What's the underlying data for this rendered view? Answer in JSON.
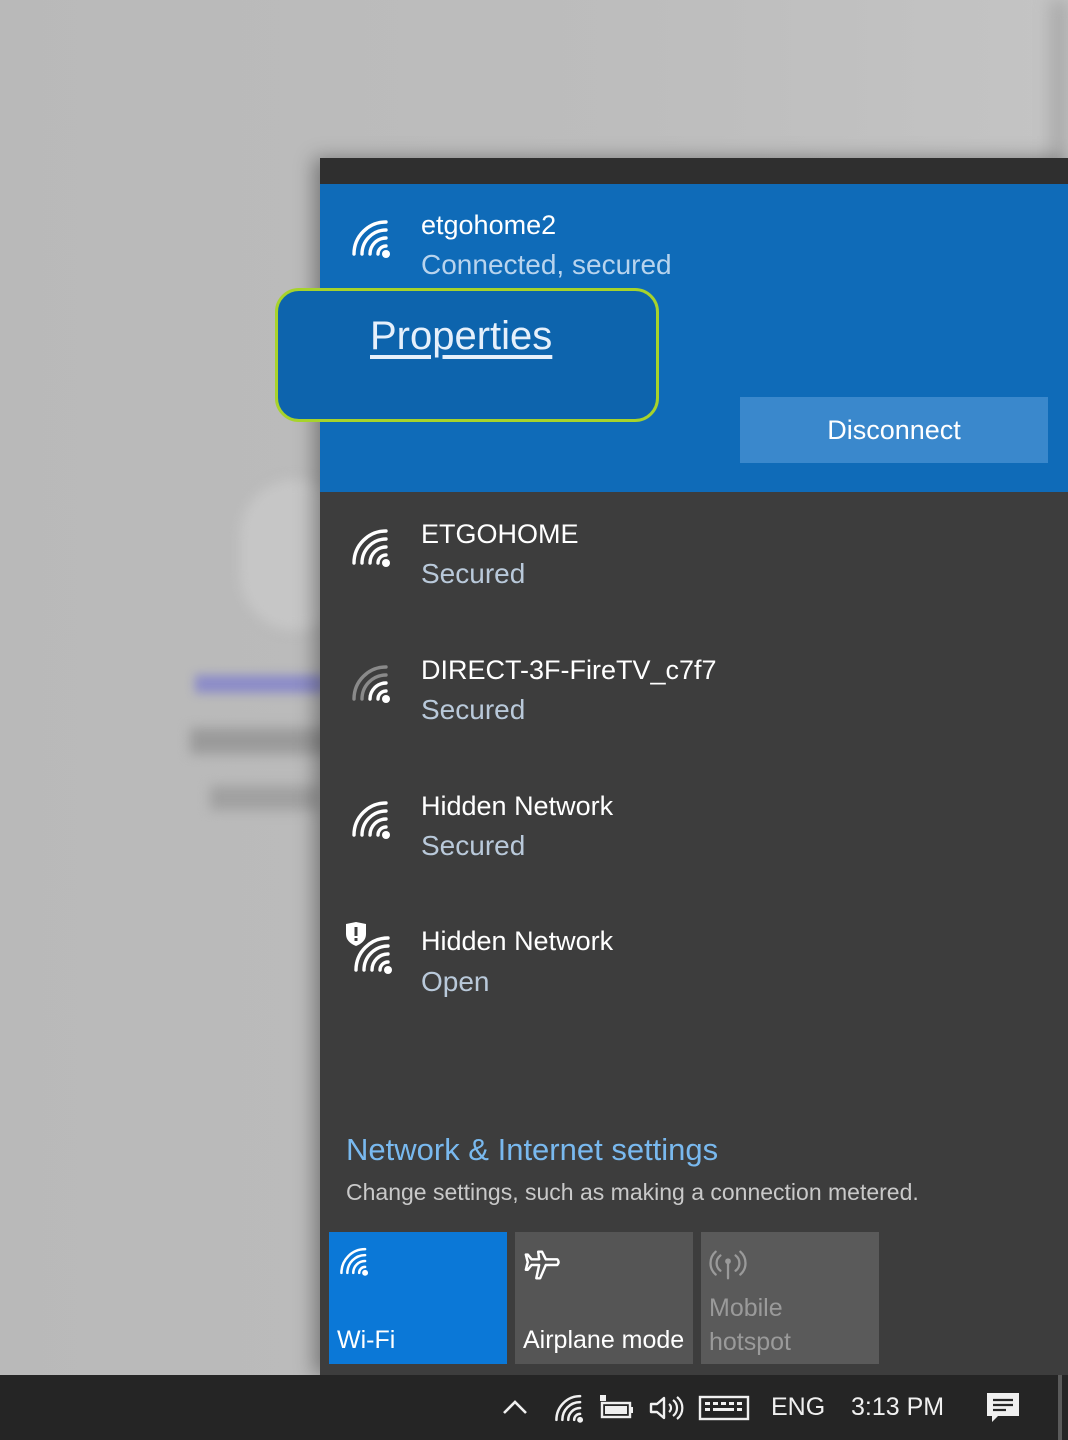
{
  "connected_network": {
    "name": "etgohome2",
    "status": "Connected, secured",
    "properties_label": "Properties",
    "disconnect_label": "Disconnect"
  },
  "networks": [
    {
      "name": "ETGOHOME",
      "status": "Secured",
      "icon": "wifi-signal-icon"
    },
    {
      "name": "DIRECT-3F-FireTV_c7f7",
      "status": "Secured",
      "icon": "wifi-signal-weak-icon"
    },
    {
      "name": "Hidden Network",
      "status": "Secured",
      "icon": "wifi-signal-icon"
    },
    {
      "name": "Hidden Network",
      "status": "Open",
      "icon": "wifi-open-shield-icon"
    }
  ],
  "settings": {
    "link": "Network & Internet settings",
    "description": "Change settings, such as making a connection metered."
  },
  "quick_actions": {
    "wifi": "Wi-Fi",
    "airplane": "Airplane mode",
    "hotspot_line1": "Mobile",
    "hotspot_line2": "hotspot"
  },
  "taskbar": {
    "language": "ENG",
    "time": "3:13 PM"
  },
  "colors": {
    "accent": "#0f6bb8",
    "highlight_outline": "#a7d32b",
    "panel_bg": "#3d3d3d",
    "wifi_tile": "#0b78d7"
  }
}
